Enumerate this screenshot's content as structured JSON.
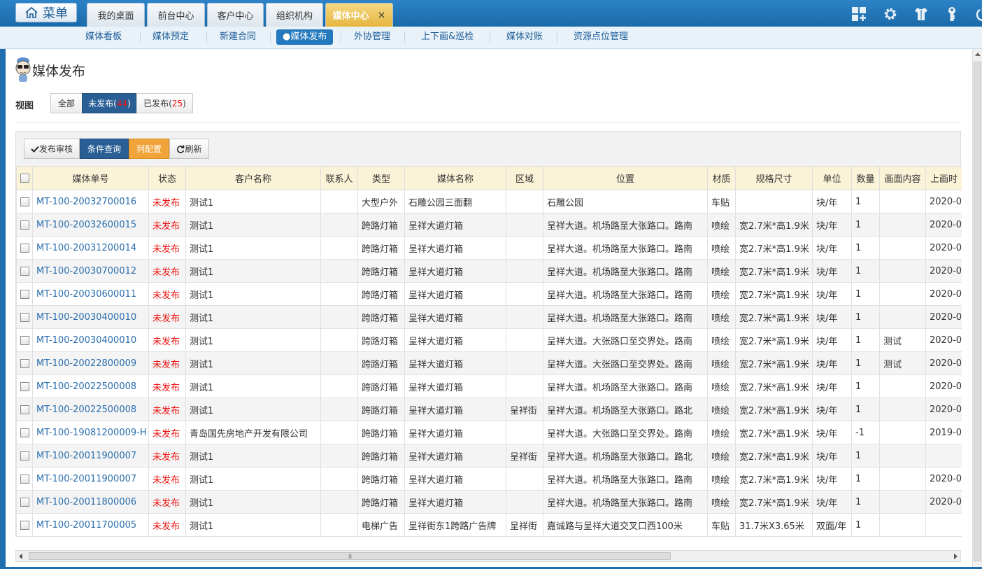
{
  "topbar": {
    "menu_label": "菜单",
    "tabs": [
      {
        "label": "我的桌面"
      },
      {
        "label": "前台中心"
      },
      {
        "label": "客户中心"
      },
      {
        "label": "组织机构"
      },
      {
        "label": "媒体中心",
        "active": true,
        "close": "×"
      }
    ],
    "icons": [
      "grid-icon",
      "gear-icon",
      "shirt-icon",
      "key-icon",
      "power-icon"
    ]
  },
  "subnav": {
    "items": [
      {
        "label": "媒体看板"
      },
      {
        "label": "媒体预定"
      },
      {
        "label": "新建合同"
      },
      {
        "label": "●媒体发布",
        "active": true
      },
      {
        "label": "外协管理"
      },
      {
        "label": "上下画&巡检"
      },
      {
        "label": "媒体对账"
      },
      {
        "label": "资源点位管理"
      }
    ]
  },
  "page": {
    "title": "媒体发布",
    "view_label": "视图",
    "views": {
      "all": "全部",
      "unpublished": "未发布",
      "unpublished_count": "44",
      "published": "已发布",
      "published_count": "25"
    }
  },
  "toolbar": {
    "audit": "发布审核",
    "query": "条件查询",
    "columns": "列配置",
    "refresh": "刷新"
  },
  "table": {
    "headers": [
      "媒体单号",
      "状态",
      "客户名称",
      "联系人",
      "类型",
      "媒体名称",
      "区域",
      "位置",
      "材质",
      "规格尺寸",
      "单位",
      "数量",
      "画面内容",
      "上画时"
    ],
    "rows": [
      [
        "MT-100-20032700016",
        "未发布",
        "测试1",
        "",
        "大型户外",
        "石雕公园三面翻",
        "",
        "石雕公园",
        "车贴",
        "",
        "块/年",
        "1",
        "",
        "2020-0"
      ],
      [
        "MT-100-20032600015",
        "未发布",
        "测试1",
        "",
        "跨路灯箱",
        "呈祥大道灯箱",
        "",
        "呈祥大道。机场路至大张路口。路南",
        "喷绘",
        "宽2.7米*高1.9米",
        "块/年",
        "1",
        "",
        "2020-0"
      ],
      [
        "MT-100-20031200014",
        "未发布",
        "测试1",
        "",
        "跨路灯箱",
        "呈祥大道灯箱",
        "",
        "呈祥大道。机场路至大张路口。路南",
        "喷绘",
        "宽2.7米*高1.9米",
        "块/年",
        "1",
        "",
        "2020-0"
      ],
      [
        "MT-100-20030700012",
        "未发布",
        "测试1",
        "",
        "跨路灯箱",
        "呈祥大道灯箱",
        "",
        "呈祥大道。机场路至大张路口。路南",
        "喷绘",
        "宽2.7米*高1.9米",
        "块/年",
        "1",
        "",
        "2020-0"
      ],
      [
        "MT-100-20030600011",
        "未发布",
        "测试1",
        "",
        "跨路灯箱",
        "呈祥大道灯箱",
        "",
        "呈祥大道。机场路至大张路口。路南",
        "喷绘",
        "宽2.7米*高1.9米",
        "块/年",
        "1",
        "",
        "2020-0"
      ],
      [
        "MT-100-20030400010",
        "未发布",
        "测试1",
        "",
        "跨路灯箱",
        "呈祥大道灯箱",
        "",
        "呈祥大道。机场路至大张路口。路南",
        "喷绘",
        "宽2.7米*高1.9米",
        "块/年",
        "1",
        "",
        "2020-0"
      ],
      [
        "MT-100-20030400010",
        "未发布",
        "测试1",
        "",
        "跨路灯箱",
        "呈祥大道灯箱",
        "",
        "呈祥大道。大张路口至交界处。路南",
        "喷绘",
        "宽2.7米*高1.9米",
        "块/年",
        "1",
        "测试",
        "2020-0"
      ],
      [
        "MT-100-20022800009",
        "未发布",
        "测试1",
        "",
        "跨路灯箱",
        "呈祥大道灯箱",
        "",
        "呈祥大道。大张路口至交界处。路南",
        "喷绘",
        "宽2.7米*高1.9米",
        "块/年",
        "1",
        "测试",
        "2020-0"
      ],
      [
        "MT-100-20022500008",
        "未发布",
        "测试1",
        "",
        "跨路灯箱",
        "呈祥大道灯箱",
        "",
        "呈祥大道。机场路至大张路口。路南",
        "喷绘",
        "宽2.7米*高1.9米",
        "块/年",
        "1",
        "",
        "2020-0"
      ],
      [
        "MT-100-20022500008",
        "未发布",
        "测试1",
        "",
        "跨路灯箱",
        "呈祥大道灯箱",
        "呈祥街",
        "呈祥大道。机场路至大张路口。路北",
        "喷绘",
        "宽2.7米*高1.9米",
        "块/年",
        "1",
        "",
        "2020-0"
      ],
      [
        "MT-100-19081200009-H",
        "未发布",
        "青岛国先房地产开发有限公司",
        "",
        "跨路灯箱",
        "呈祥大道灯箱",
        "",
        "呈祥大道。大张路口至交界处。路南",
        "喷绘",
        "宽2.7米*高1.9米",
        "块/年",
        "-1",
        "",
        "2019-0"
      ],
      [
        "MT-100-20011900007",
        "未发布",
        "测试1",
        "",
        "跨路灯箱",
        "呈祥大道灯箱",
        "呈祥街",
        "呈祥大道。机场路至大张路口。路北",
        "喷绘",
        "宽2.7米*高1.9米",
        "块/年",
        "1",
        "",
        ""
      ],
      [
        "MT-100-20011900007",
        "未发布",
        "测试1",
        "",
        "跨路灯箱",
        "呈祥大道灯箱",
        "",
        "呈祥大道。机场路至大张路口。路南",
        "喷绘",
        "宽2.7米*高1.9米",
        "块/年",
        "1",
        "",
        "2020-0"
      ],
      [
        "MT-100-20011800006",
        "未发布",
        "测试1",
        "",
        "跨路灯箱",
        "呈祥大道灯箱",
        "",
        "呈祥大道。机场路至大张路口。路南",
        "喷绘",
        "宽2.7米*高1.9米",
        "块/年",
        "1",
        "",
        "2020-0"
      ],
      [
        "MT-100-20011700005",
        "未发布",
        "测试1",
        "",
        "电梯广告",
        "呈祥街东1跨路广告牌",
        "呈祥街",
        "嘉诚路与呈祥大道交叉口西100米",
        "车贴",
        "31.7米X3.65米",
        "双面/年",
        "1",
        "",
        ""
      ]
    ]
  },
  "scrollbar": {
    "grip": "III"
  }
}
